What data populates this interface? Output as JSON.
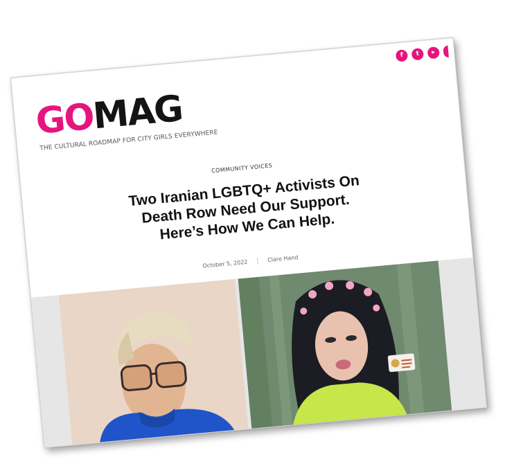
{
  "site": {
    "logo_go": "GO",
    "logo_mag": "MAG",
    "tagline": "THE CULTURAL ROADMAP FOR CITY GIRLS EVERYWHERE"
  },
  "social": [
    {
      "icon": "facebook-icon",
      "glyph": "f"
    },
    {
      "icon": "twitter-icon",
      "glyph": "t"
    },
    {
      "icon": "youtube-icon",
      "glyph": "▸"
    }
  ],
  "article": {
    "category": "COMMUNITY VOICES",
    "title": "Two Iranian LGBTQ+ Activists On Death Row Need Our Support. Here’s How We Can Help.",
    "date": "October 5, 2022",
    "author": "Clare Hand"
  },
  "images": {
    "left_alt": "photo-activist-1",
    "right_alt": "photo-activist-2"
  },
  "colors": {
    "brand_pink": "#e6157e",
    "text_dark": "#141414"
  }
}
